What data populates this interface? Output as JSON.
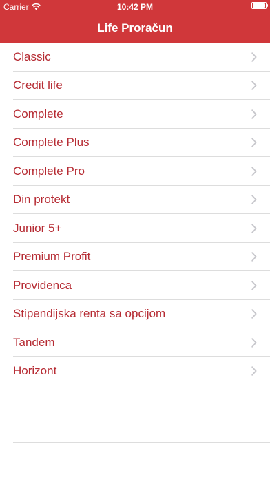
{
  "status_bar": {
    "carrier": "Carrier",
    "time": "10:42 PM",
    "wifi_icon": "wifi-icon",
    "battery_icon": "battery-icon",
    "battery_level": 1.0
  },
  "nav": {
    "title": "Life Proračun"
  },
  "colors": {
    "bar": "#d0373a",
    "label": "#b62b33",
    "separator": "#dddddd",
    "chevron": "#c7c7cc"
  },
  "list": {
    "items": [
      {
        "label": "Classic"
      },
      {
        "label": "Credit life"
      },
      {
        "label": "Complete"
      },
      {
        "label": "Complete Plus"
      },
      {
        "label": "Complete Pro"
      },
      {
        "label": "Din protekt"
      },
      {
        "label": "Junior 5+"
      },
      {
        "label": "Premium Profit"
      },
      {
        "label": "Providenca"
      },
      {
        "label": "Stipendijska renta sa opcijom"
      },
      {
        "label": "Tandem"
      },
      {
        "label": "Horizont"
      }
    ],
    "chevron_icon": "chevron-right-icon"
  }
}
